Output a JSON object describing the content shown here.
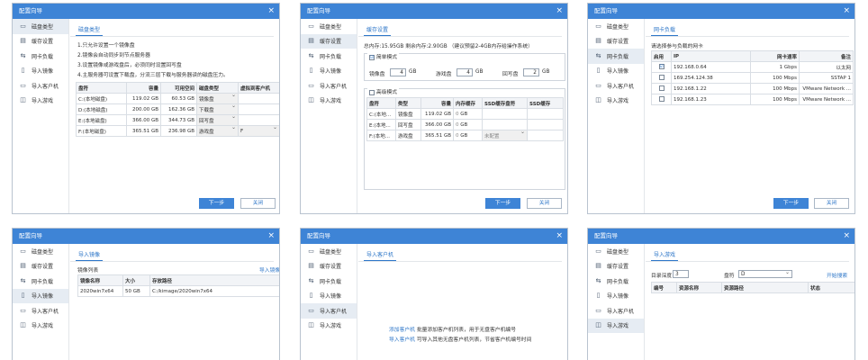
{
  "wizard_title": "配置向导",
  "close_glyph": "×",
  "sidebar": [
    "磁盘类型",
    "缓存设置",
    "网卡负载",
    "导入镜像",
    "导入客户机",
    "导入游戏"
  ],
  "sidebar_icons": [
    "disk-icon",
    "cache-icon",
    "network-icon",
    "image-icon",
    "client-icon",
    "game-icon"
  ],
  "buttons": {
    "next": "下一步",
    "close": "关闭"
  },
  "disk": {
    "tab": "磁盘类型",
    "notes": [
      "1.只允许设置一个镜像盘",
      "2.镜像会自动同步到节点服务器",
      "3.设置镜像或游戏盘后，必须同时设置回写盘",
      "4.主服务器可设置下载盘，分流三层下载与服务器读的磁盘压力。"
    ],
    "headers": [
      "盘符",
      "容量",
      "可用空间",
      "磁盘类型",
      "虚拟到客户机"
    ],
    "rows": [
      {
        "drive": "C:(本地磁盘)",
        "cap": "119.02 GB",
        "free": "60.53 GB",
        "type": "镜像盘",
        "virt": ""
      },
      {
        "drive": "D:(本地磁盘)",
        "cap": "200.00 GB",
        "free": "162.36 GB",
        "type": "下载盘",
        "virt": ""
      },
      {
        "drive": "E:(本地磁盘)",
        "cap": "366.00 GB",
        "free": "344.73 GB",
        "type": "回写盘",
        "virt": ""
      },
      {
        "drive": "F:(本地磁盘)",
        "cap": "365.51 GB",
        "free": "236.98 GB",
        "type": "游戏盘",
        "virt": "F"
      }
    ]
  },
  "cache": {
    "tab": "缓存设置",
    "info": "总内存:15.95GB 剩余内存:2.90GB （建议预留2-4GB内存给操作系统）",
    "simple_label": "简单模式",
    "simple_checked": "☑",
    "image_label": "镜像盘",
    "image_val": "4",
    "gb": "GB",
    "game_label": "游戏盘",
    "game_val": "4",
    "writeback_label": "回写盘",
    "writeback_val": "2",
    "adv_label": "高级模式",
    "headers": [
      "盘符",
      "类型",
      "容量",
      "内存缓存",
      "SSD缓存盘符",
      "SSD缓存"
    ],
    "rows": [
      {
        "drive": "C:(本地...",
        "type": "镜像盘",
        "cap": "119.02 GB",
        "mem": "0",
        "unit": "GB",
        "ssd": "",
        "ssdc": ""
      },
      {
        "drive": "E:(本地...",
        "type": "回写盘",
        "cap": "366.00 GB",
        "mem": "0",
        "unit": "GB",
        "ssd": "",
        "ssdc": ""
      },
      {
        "drive": "F:(本地...",
        "type": "游戏盘",
        "cap": "365.51 GB",
        "mem": "0",
        "unit": "GB",
        "ssd": "未配置",
        "ssdc": ""
      }
    ]
  },
  "nic": {
    "tab": "网卡负载",
    "desc": "请选择参与负载的网卡",
    "headers": [
      "启用",
      "IP",
      "网卡速率",
      "备注"
    ],
    "rows": [
      {
        "on": "☑",
        "ip": "192.168.0.64",
        "speed": "1 Gbps",
        "note": "以太网"
      },
      {
        "on": "",
        "ip": "169.254.124.38",
        "speed": "100 Mbps",
        "note": "SSTAP 1"
      },
      {
        "on": "",
        "ip": "192.168.1.22",
        "speed": "100 Mbps",
        "note": "VMware Network ..."
      },
      {
        "on": "",
        "ip": "192.168.1.23",
        "speed": "100 Mbps",
        "note": "VMware Network ..."
      }
    ]
  },
  "image": {
    "tab": "导入镜像",
    "list_title": "镜像列表",
    "import_link": "导入镜像",
    "headers": [
      "镜像名称",
      "大小",
      "存放路径"
    ],
    "rows": [
      {
        "name": "2020win7x64",
        "size": "50 GB",
        "path": "C:/kimage/2020win7x64"
      }
    ]
  },
  "client": {
    "tab": "导入客户机",
    "line1_link": "添加客户机",
    "line1_text": "批量添加客户机列表，用于无盘客户机编号",
    "line2_link": "导入客户机",
    "line2_text": "可导入其他无盘客户机列表，节省客户机编号时间"
  },
  "game": {
    "tab": "导入游戏",
    "depth_label": "目录深度",
    "depth_val": "3",
    "drive_label": "盘符",
    "drive_val": "D",
    "scan_link": "开始搜索",
    "headers": [
      "编号",
      "资源名称",
      "资源路径",
      "状态"
    ]
  }
}
